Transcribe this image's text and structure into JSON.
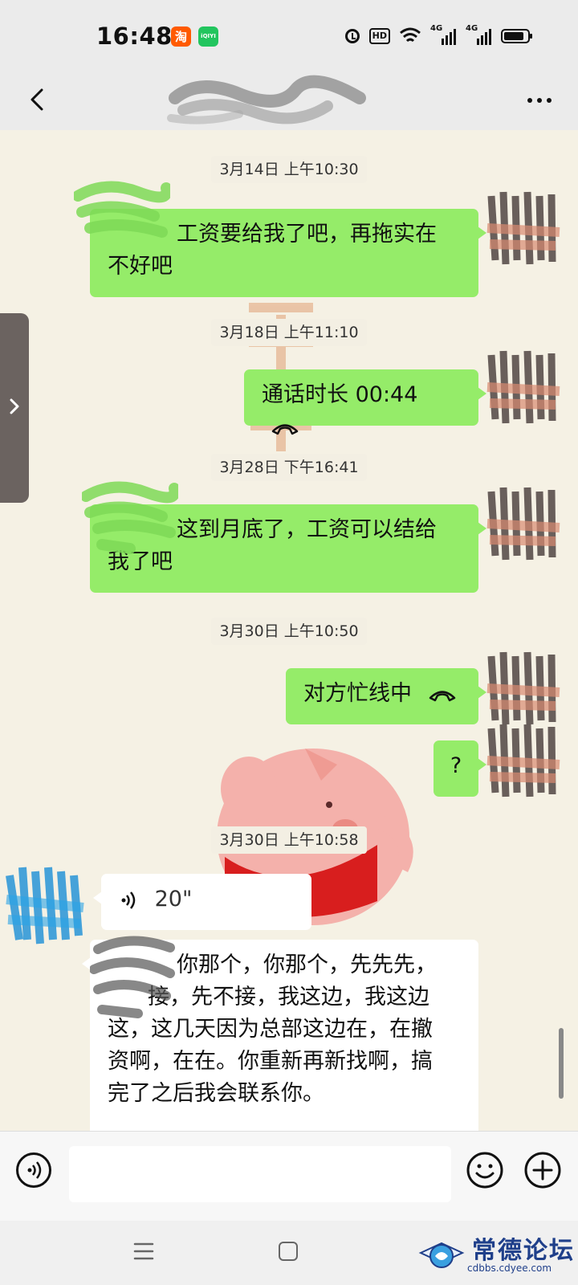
{
  "status_bar": {
    "time": "16:48",
    "icons": [
      "taobao-app-badge",
      "iqiyi-app-badge",
      "alarm-icon",
      "hd-icon",
      "wifi-icon",
      "signal-4g-icon",
      "signal-4g-icon",
      "battery-icon"
    ],
    "iqiyi_label": "iQIYI",
    "hd_label": "HD",
    "network_labels": [
      "4G",
      "4G"
    ],
    "battery_level": 0.85
  },
  "nav_bar": {
    "back_icon": "chevron-left-icon",
    "more_icon": "more-dots-icon"
  },
  "messages": [
    {
      "type": "timestamp",
      "text": "3月14日 上午10:30"
    },
    {
      "type": "text",
      "direction": "out",
      "text_line1": "工资要给我了吧，再拖实在",
      "text_line2": "不好吧"
    },
    {
      "type": "timestamp",
      "text": "3月18日 上午11:10"
    },
    {
      "type": "call",
      "direction": "out",
      "text": "通话时长 00:44",
      "icon": "phone-hangup-icon"
    },
    {
      "type": "timestamp",
      "text": "3月28日 下午16:41"
    },
    {
      "type": "text",
      "direction": "out",
      "text_line1": "这到月底了，工资可以结给",
      "text_line2": "我了吧"
    },
    {
      "type": "timestamp",
      "text": "3月30日 上午10:50"
    },
    {
      "type": "call",
      "direction": "out",
      "text": "对方忙线中",
      "icon": "phone-hangup-icon"
    },
    {
      "type": "text",
      "direction": "out",
      "text": "?"
    },
    {
      "type": "timestamp",
      "text": "3月30日 上午10:58"
    },
    {
      "type": "voice",
      "direction": "in",
      "duration": "20\"",
      "icon": "voice-wave-icon"
    },
    {
      "type": "transcription",
      "direction": "in",
      "lines": [
        "你那个，你那个，先先先，",
        "接，先不接，我这边，我这边",
        "这，这几天因为总部这边在，在撤",
        "资啊，在在。你重新再新找啊，搞",
        "完了之后我会联系你。"
      ]
    }
  ],
  "input_bar": {
    "voice_toggle_icon": "voice-toggle-icon",
    "text_value": "",
    "emoji_icon": "emoji-icon",
    "plus_icon": "plus-icon"
  },
  "system_nav": {
    "menu_icon": "menu-icon",
    "home_icon": "home-icon"
  },
  "watermark": {
    "title": "常德论坛",
    "url": "cdbbs.cdyee.com"
  },
  "colors": {
    "outgoing_bubble": "#95ec69",
    "incoming_bubble": "#ffffff",
    "chat_background": "#f5f1e4",
    "bar_background": "#ebebeb",
    "watermark_blue": "#1f3f8a"
  }
}
